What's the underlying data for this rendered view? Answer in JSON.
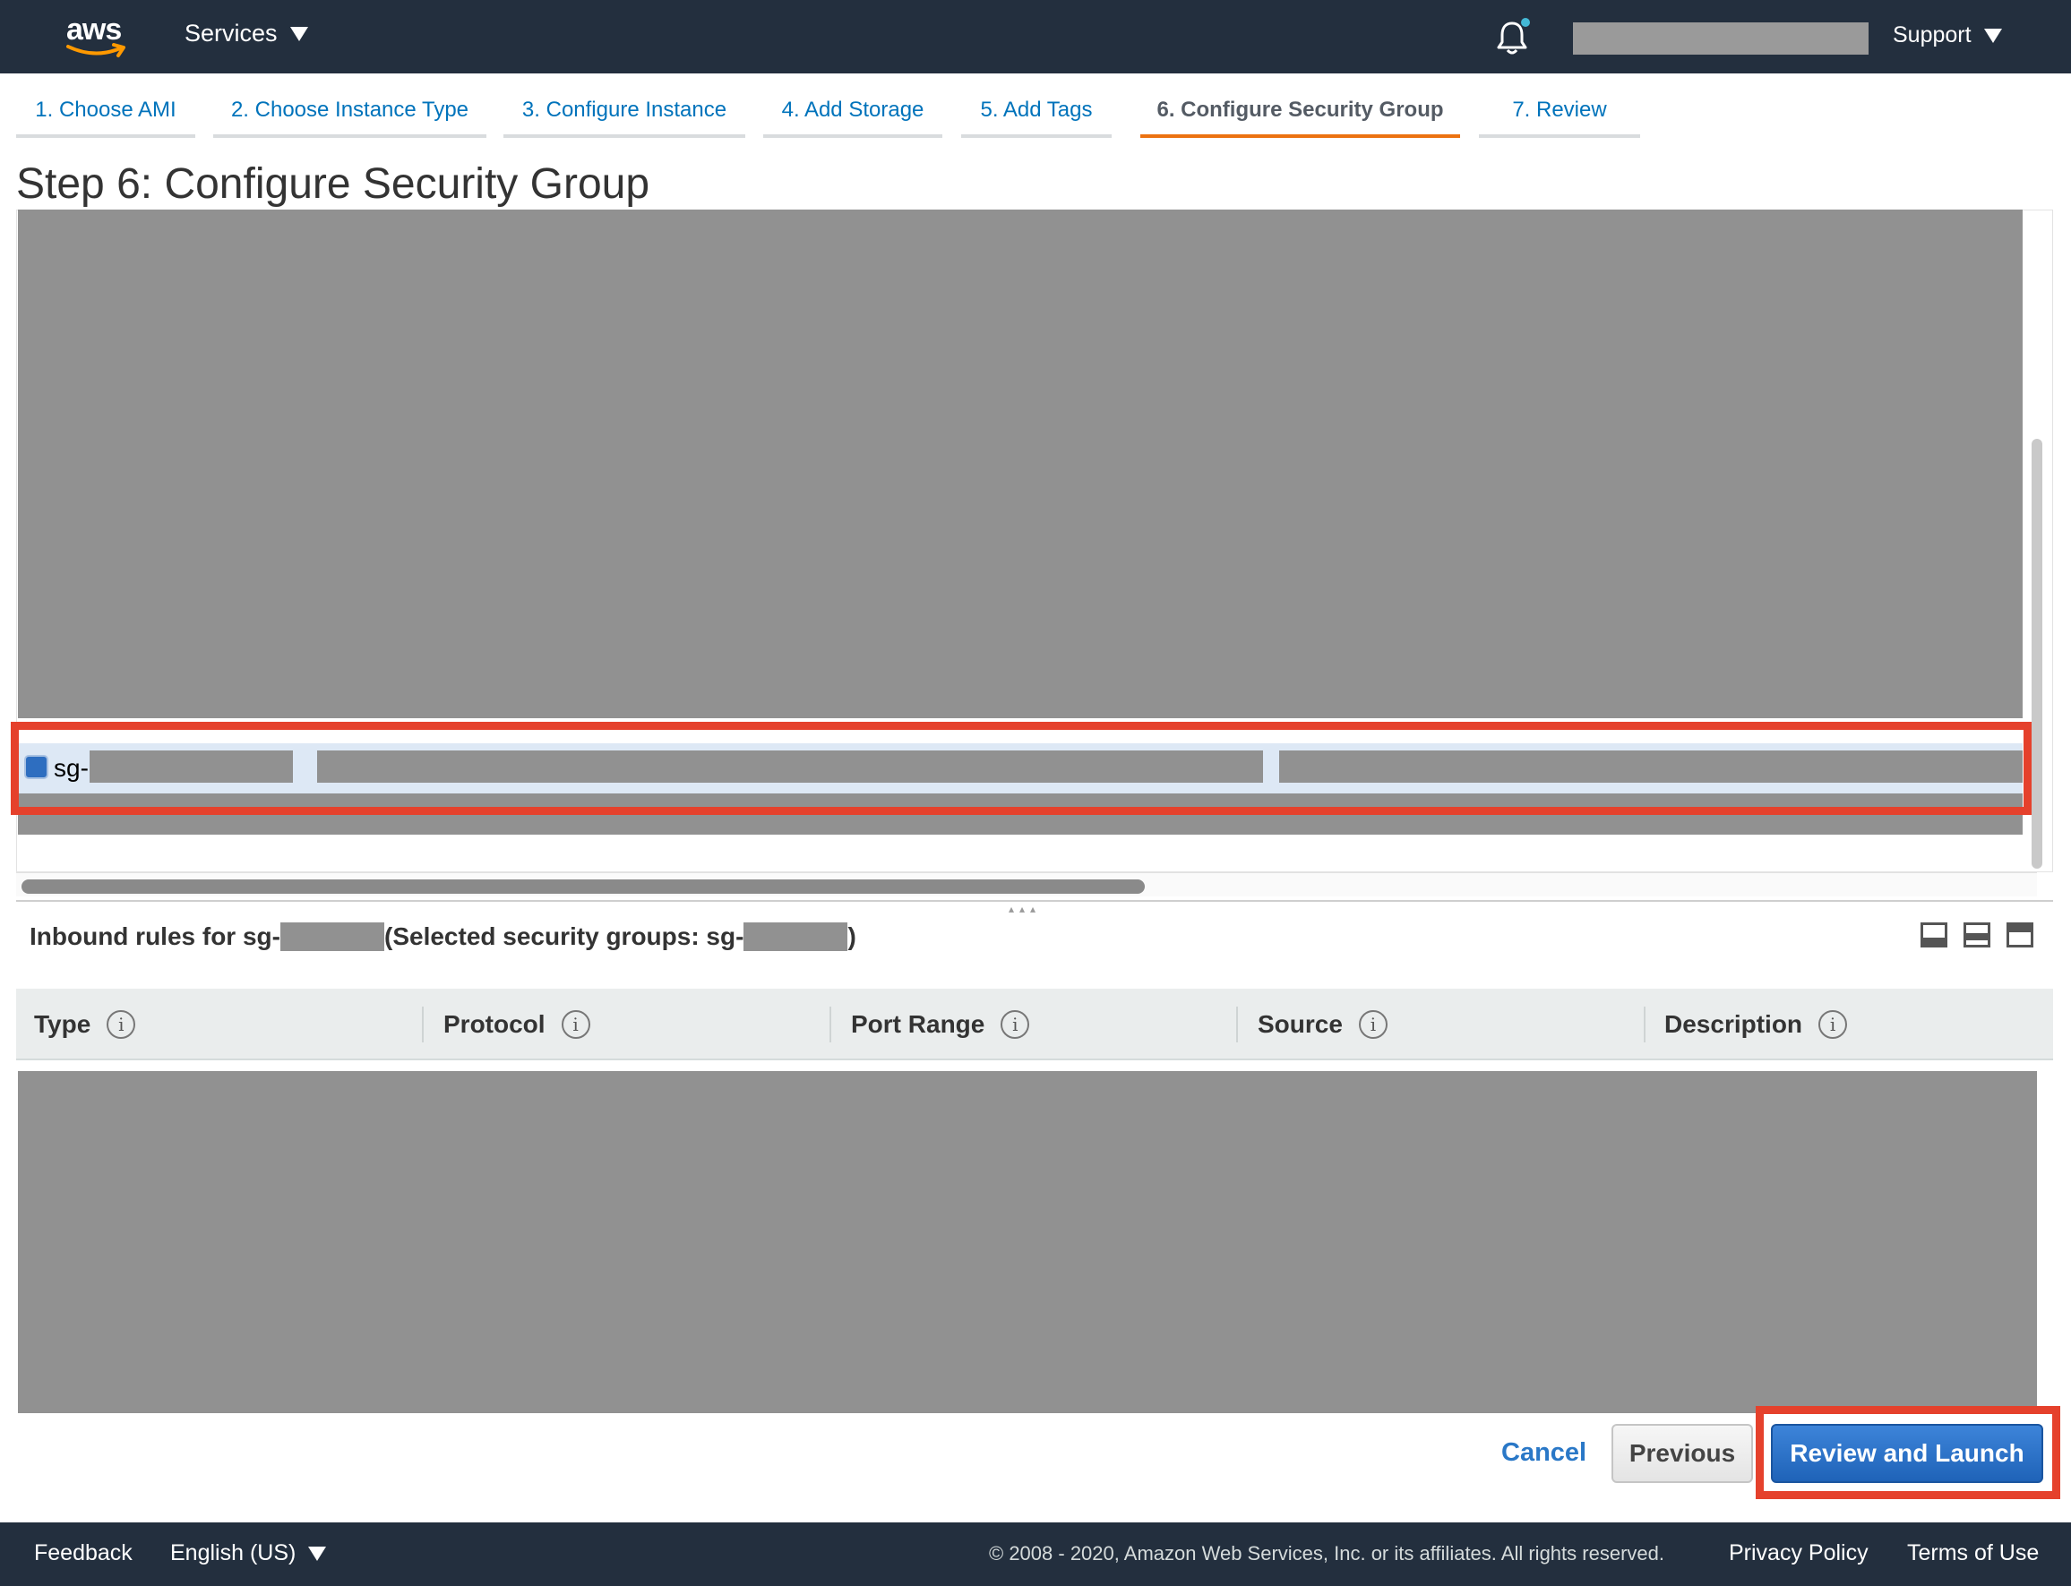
{
  "nav": {
    "logo_text": "aws",
    "services_label": "Services",
    "support_label": "Support"
  },
  "tabs": [
    {
      "label": "1. Choose AMI"
    },
    {
      "label": "2. Choose Instance Type"
    },
    {
      "label": "3. Configure Instance"
    },
    {
      "label": "4. Add Storage"
    },
    {
      "label": "5. Add Tags"
    },
    {
      "label": "6. Configure Security Group",
      "active": true
    },
    {
      "label": "7. Review"
    }
  ],
  "page_title": "Step 6: Configure Security Group",
  "security_group_row": {
    "id_prefix": "sg-",
    "selected": true
  },
  "inbound": {
    "title_prefix": "Inbound rules for sg-",
    "title_middle": "(Selected security groups: sg-",
    "title_suffix": ")"
  },
  "rules_table": {
    "columns": [
      "Type",
      "Protocol",
      "Port Range",
      "Source",
      "Description"
    ]
  },
  "buttons": {
    "cancel": "Cancel",
    "previous": "Previous",
    "review_launch": "Review and Launch"
  },
  "footer": {
    "feedback": "Feedback",
    "language": "English (US)",
    "copyright": "© 2008 - 2020, Amazon Web Services, Inc. or its affiliates. All rights reserved.",
    "privacy": "Privacy Policy",
    "terms": "Terms of Use"
  },
  "colors": {
    "nav_bg": "#232f3e",
    "active_tab": "#ec7211",
    "link": "#0073bb",
    "primary_button": "#2b6fc7",
    "highlight": "#e5412c",
    "redaction": "#919191"
  }
}
